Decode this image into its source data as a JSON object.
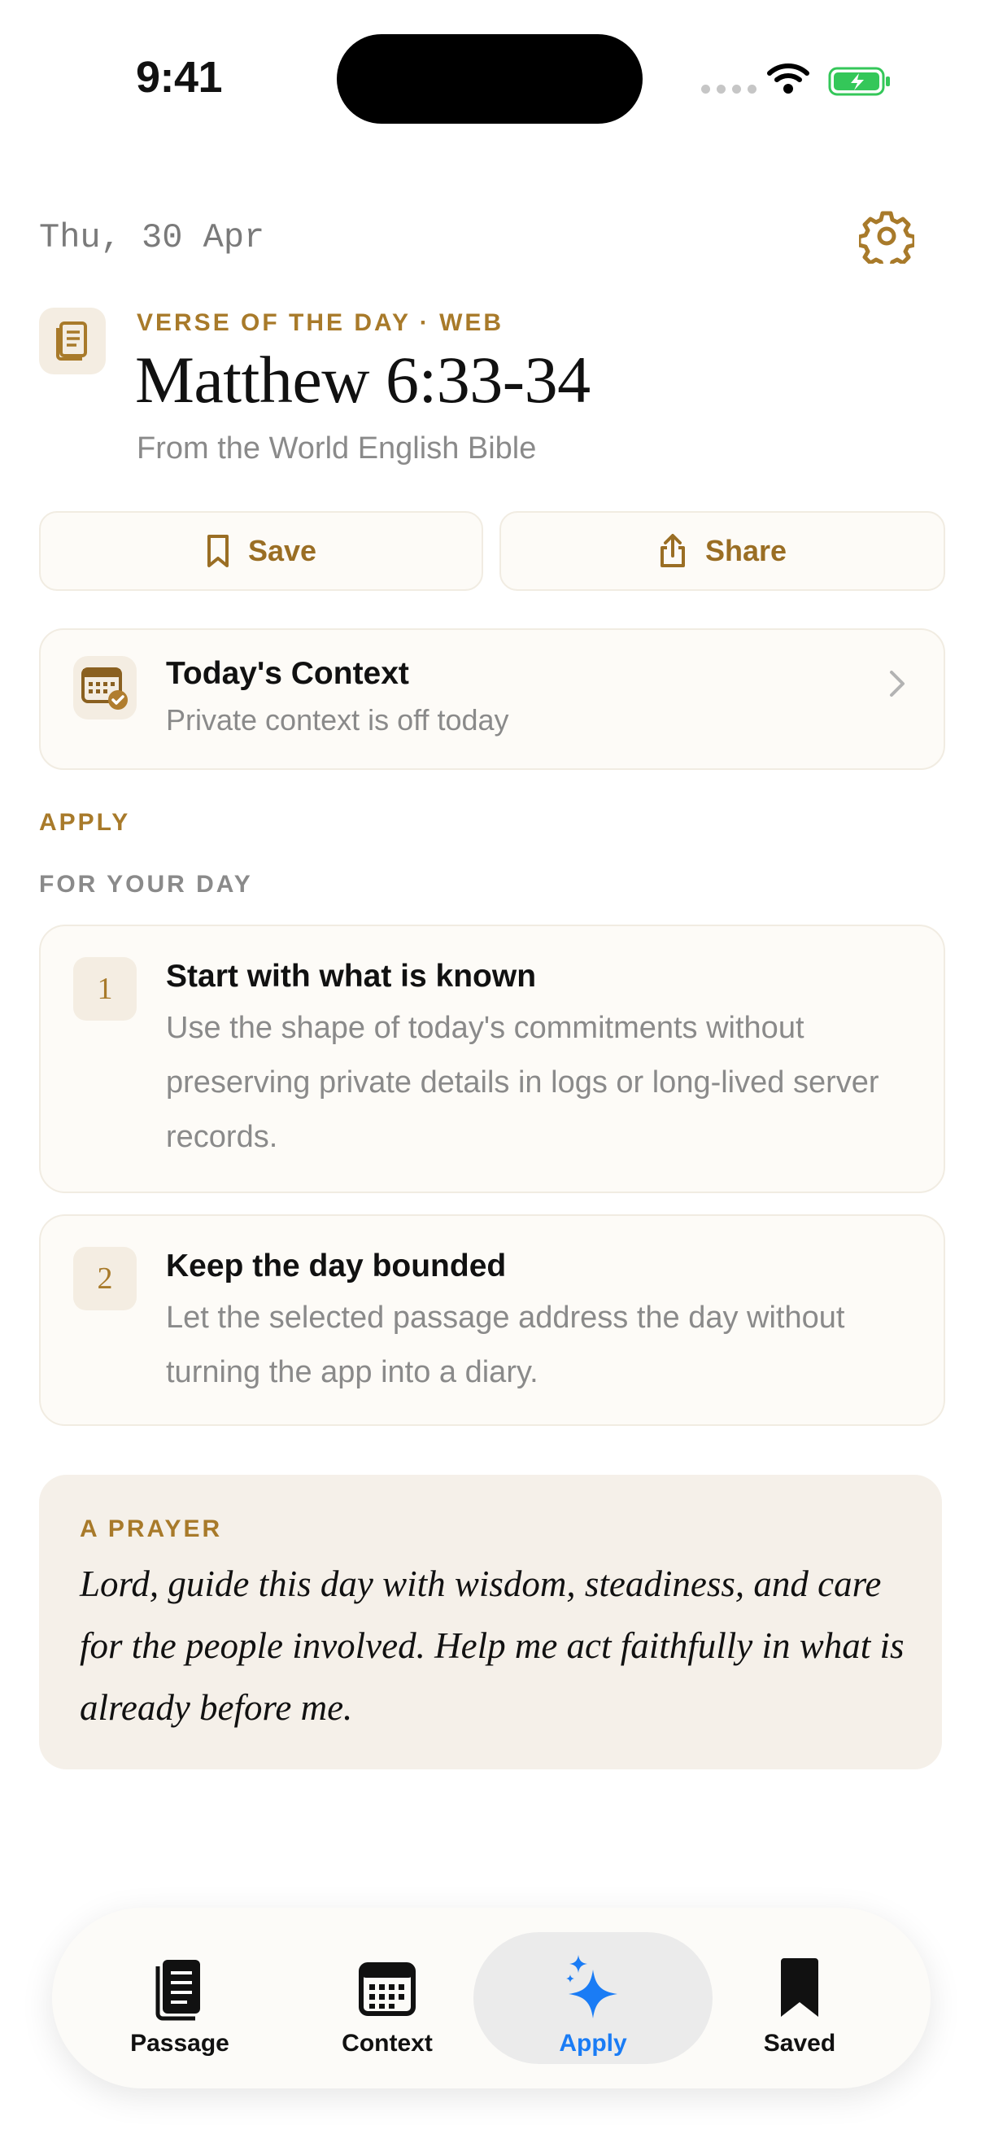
{
  "status_bar": {
    "time": "9:41"
  },
  "header": {
    "date": "Thu, 30 Apr"
  },
  "verse": {
    "kicker": "VERSE OF THE DAY · WEB",
    "reference": "Matthew 6:33-34",
    "source": "From the World English Bible"
  },
  "actions": {
    "save_label": "Save",
    "share_label": "Share"
  },
  "context_card": {
    "title": "Today's Context",
    "subtitle": "Private context is off today"
  },
  "apply": {
    "section_label": "APPLY",
    "subsection_label": "FOR YOUR DAY",
    "steps": [
      {
        "number": "1",
        "title": "Start with what is known",
        "body": "Use the shape of today's commitments without preserving private details in logs or long-lived server records."
      },
      {
        "number": "2",
        "title": "Keep the day bounded",
        "body": "Let the selected passage address the day without turning the app into a diary."
      }
    ]
  },
  "prayer": {
    "label": "A PRAYER",
    "text": "Lord, guide this day with wisdom, steadiness, and care for the people involved. Help me act faithfully in what is already before me."
  },
  "tab_bar": {
    "active": "Apply",
    "items": [
      {
        "label": "Passage",
        "icon": "book-icon"
      },
      {
        "label": "Context",
        "icon": "calendar-icon"
      },
      {
        "label": "Apply",
        "icon": "sparkles-icon"
      },
      {
        "label": "Saved",
        "icon": "bookmark-icon"
      }
    ]
  },
  "colors": {
    "accent": "#a87a2a",
    "active_tab": "#1a7cf5",
    "card_bg": "#fdfbf7",
    "prayer_bg": "#f5f0e9",
    "muted_text": "#8a8a8a"
  }
}
